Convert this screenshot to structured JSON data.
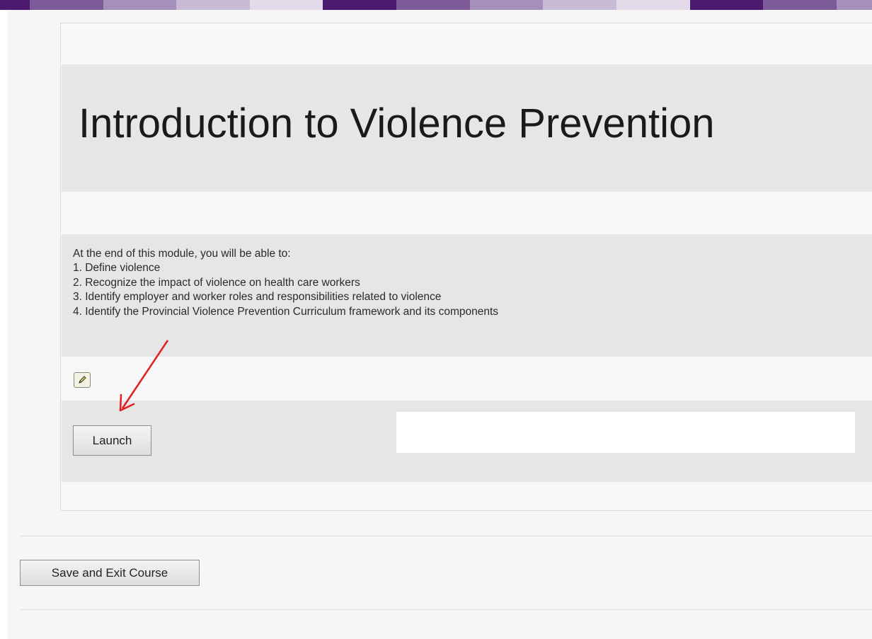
{
  "course": {
    "title": "Introduction to Violence Prevention",
    "objectives_intro": "At the end of this module, you will be able to:",
    "objectives": [
      "1. Define violence",
      "2. Recognize the impact of violence on health care workers",
      "3. Identify employer and worker roles and responsibilities related to violence",
      "4. Identify the Provincial Violence Prevention Curriculum framework and its components"
    ]
  },
  "icons": {
    "edit": "pencil-icon",
    "annotation": "red-arrow"
  },
  "buttons": {
    "launch_label": "Launch",
    "save_exit_label": "Save and Exit Course"
  },
  "colors": {
    "stripe": [
      "#4b1a6e",
      "#7d5a98",
      "#a58fbb",
      "#c9bad6",
      "#e3dbea"
    ],
    "annotation": "#e02020"
  }
}
